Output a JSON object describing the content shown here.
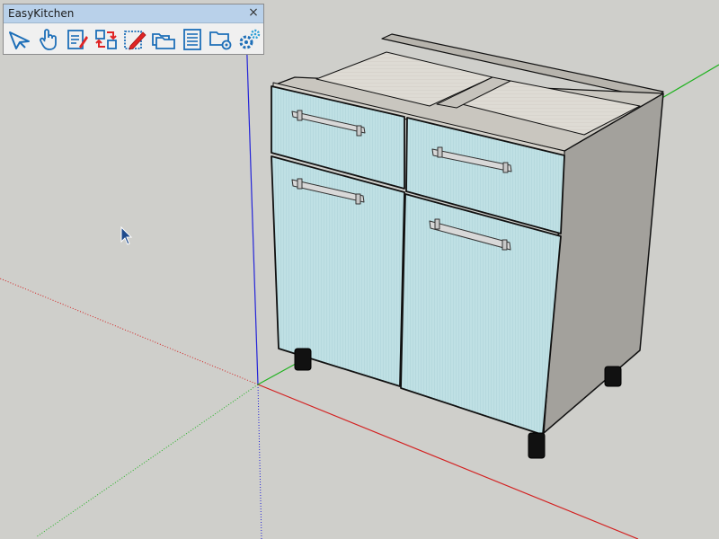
{
  "toolbar": {
    "title": "EasyKitchen",
    "close_glyph": "×",
    "tools": [
      {
        "name": "select-arrow-icon"
      },
      {
        "name": "hand-pointer-icon"
      },
      {
        "name": "edit-form-icon"
      },
      {
        "name": "swap-arrows-icon"
      },
      {
        "name": "edit-pencil-icon"
      },
      {
        "name": "folders-icon"
      },
      {
        "name": "list-table-icon"
      },
      {
        "name": "folder-settings-icon"
      },
      {
        "name": "gears-icon"
      }
    ]
  },
  "colors": {
    "background": "#cfcfcb",
    "door_fill": "#bfe0e4",
    "carcass_side": "#a3a19c",
    "axis_red": "#d32020",
    "axis_green": "#1fb21f",
    "axis_blue": "#2424d8",
    "icon_blue": "#1e6fb8",
    "icon_red": "#e02424"
  }
}
